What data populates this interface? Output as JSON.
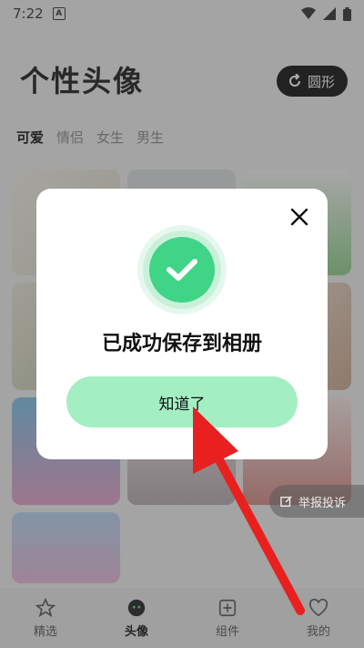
{
  "status_bar": {
    "time": "7:22",
    "badge": "A"
  },
  "header": {
    "title": "个性头像",
    "shape_button_label": "圆形"
  },
  "tabs": [
    {
      "label": "可爱",
      "active": true
    },
    {
      "label": "情侣",
      "active": false
    },
    {
      "label": "女生",
      "active": false
    },
    {
      "label": "男生",
      "active": false
    }
  ],
  "dialog": {
    "message": "已成功保存到相册",
    "confirm_label": "知道了"
  },
  "report_button": {
    "label": "举报投诉"
  },
  "bottom_nav": [
    {
      "label": "精选",
      "icon": "star-icon",
      "active": false
    },
    {
      "label": "头像",
      "icon": "face-icon",
      "active": true
    },
    {
      "label": "组件",
      "icon": "plus-square-icon",
      "active": false
    },
    {
      "label": "我的",
      "icon": "heart-face-icon",
      "active": false
    }
  ],
  "colors": {
    "accent_green": "#3fd486",
    "button_green": "#a3efc3",
    "arrow_red": "#e8201f"
  }
}
